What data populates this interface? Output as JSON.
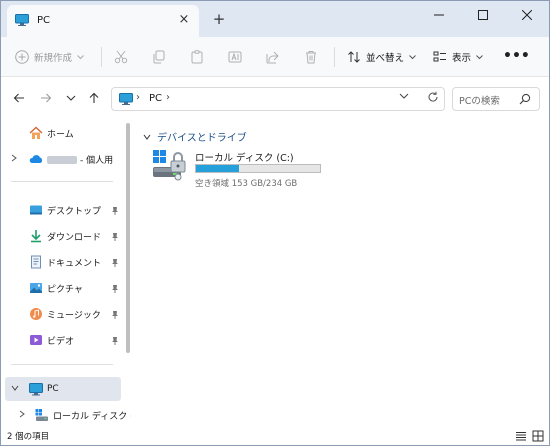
{
  "tab": {
    "title": "PC",
    "close": "×",
    "new_tab": "+"
  },
  "window_controls": {
    "minimize": "minimize",
    "maximize": "maximize",
    "close": "close"
  },
  "toolbar": {
    "new_label": "新規作成",
    "sort_label": "並べ替え",
    "view_label": "表示",
    "more": "•••"
  },
  "address": {
    "location": "PC",
    "separator": "›"
  },
  "search": {
    "placeholder": "PCの検索"
  },
  "sidebar": {
    "items": [
      {
        "label": "ホーム",
        "icon": "home-icon"
      },
      {
        "label": "- 個人用",
        "icon": "onedrive-icon"
      },
      {
        "label": "デスクトップ",
        "icon": "desktop-icon",
        "pinned": true
      },
      {
        "label": "ダウンロード",
        "icon": "download-icon",
        "pinned": true
      },
      {
        "label": "ドキュメント",
        "icon": "document-icon",
        "pinned": true
      },
      {
        "label": "ピクチャ",
        "icon": "pictures-icon",
        "pinned": true
      },
      {
        "label": "ミュージック",
        "icon": "music-icon",
        "pinned": true
      },
      {
        "label": "ビデオ",
        "icon": "video-icon",
        "pinned": true
      },
      {
        "label": "PC",
        "icon": "pc-icon",
        "selected": true
      },
      {
        "label": "ローカル ディスク (C",
        "icon": "local-disk-icon"
      }
    ]
  },
  "content": {
    "group_title": "デバイスとドライブ",
    "drive": {
      "name": "ローカル ディスク (C:)",
      "free_text": "空き領域 153 GB/234 GB",
      "used_fraction": 0.346
    }
  },
  "status": {
    "item_count": "2 個の項目"
  },
  "colors": {
    "accent": "#26a0da",
    "tab_bar": "#dfe7f2",
    "selected": "#e1e6ee"
  }
}
